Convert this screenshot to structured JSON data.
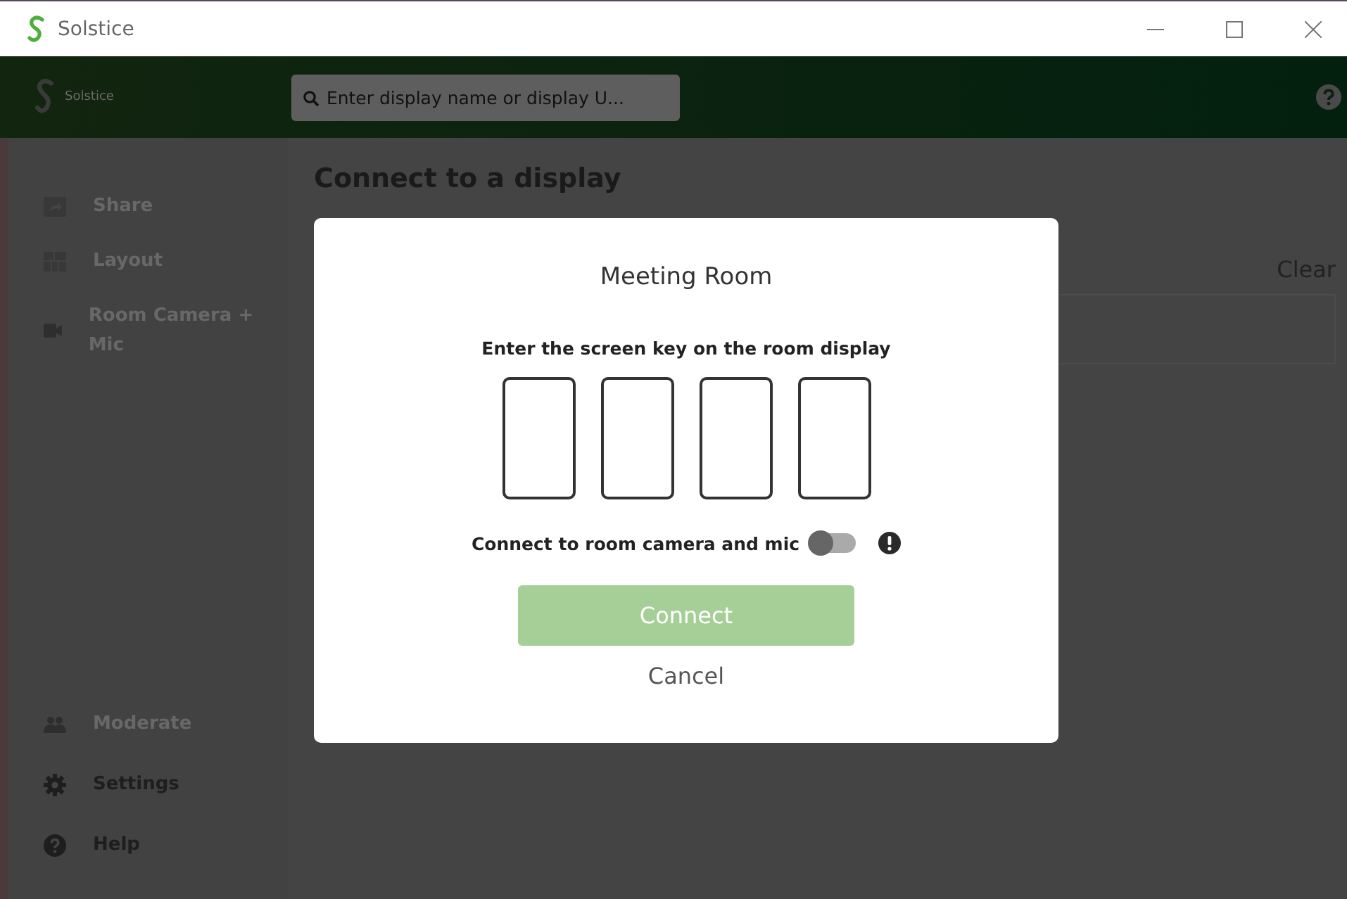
{
  "window": {
    "title": "Solstice"
  },
  "header": {
    "brand": "Solstice",
    "search": {
      "placeholder": "Enter display name or display U..."
    }
  },
  "sidebar": {
    "items": [
      {
        "label": "Share",
        "disabled": true
      },
      {
        "label": "Layout",
        "disabled": true
      },
      {
        "label": "Room Camera + Mic",
        "disabled": true
      }
    ],
    "footer_items": [
      {
        "label": "Moderate",
        "disabled": true
      },
      {
        "label": "Settings",
        "disabled": false
      },
      {
        "label": "Help",
        "disabled": false
      }
    ]
  },
  "main": {
    "heading": "Connect to a display",
    "clear_link": "Clear"
  },
  "dialog": {
    "title": "Meeting Room",
    "instruction": "Enter the screen key on the room display",
    "key_boxes": [
      {
        "filled": false
      },
      {
        "filled": false
      },
      {
        "filled": false
      },
      {
        "filled": false
      }
    ],
    "camera_toggle": {
      "label": "Connect to room camera and mic",
      "on": false
    },
    "connect_button": {
      "label": "Connect",
      "disabled": true
    },
    "cancel_link": "Cancel"
  }
}
